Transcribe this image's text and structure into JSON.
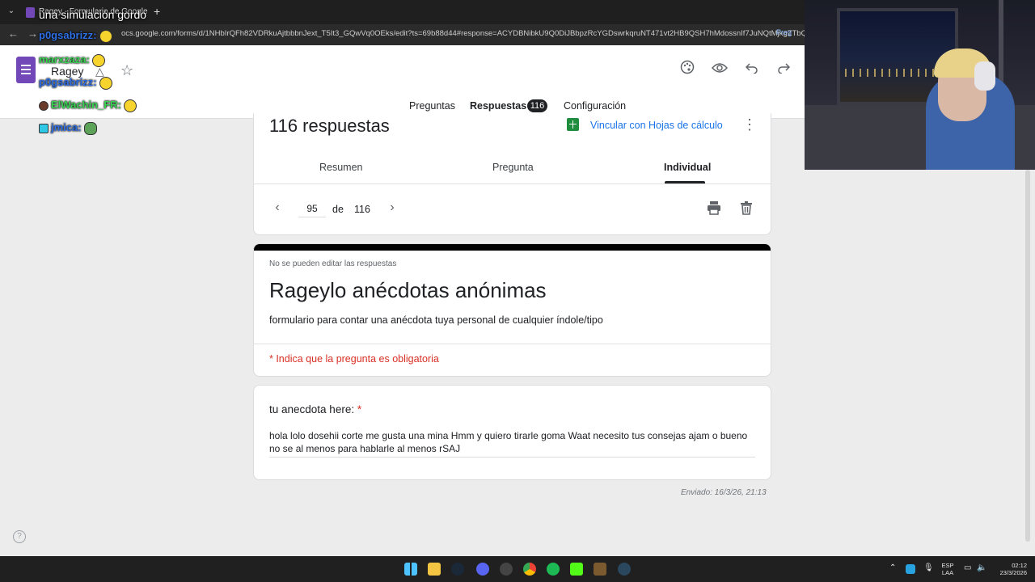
{
  "browser": {
    "tab_title": "Ragey - Formulario de Google",
    "url": "ocs.google.com/forms/d/1NHbIrQFh82VDRkuAjtbbbnJext_T5It3_GQwVq0OEks/edit?ts=69b88d44#response=ACYDBNibkU9Q0DiJBbpzRcYGDswrkqruNT471vt2HB9QSH7hMdossnIf7JuNQtMjkgZTbQk",
    "url_right": "Preg"
  },
  "header": {
    "doc_title": "Ragey",
    "tabs": {
      "questions": "Preguntas",
      "responses": "Respuestas",
      "responses_count": "116",
      "settings": "Configuración"
    }
  },
  "chat": {
    "caption": "una simulación gordo",
    "messages": [
      {
        "user": "p0gsabrizz",
        "color": "#2f6fe6"
      },
      {
        "user": "marxzaza",
        "color": "#39d353"
      },
      {
        "user": "p0gsabrizz",
        "color": "#2f6fe6"
      },
      {
        "user": "ElWachin_FR",
        "color": "#39d353"
      },
      {
        "user": "jmica",
        "color": "#2f6fe6"
      }
    ]
  },
  "responses_card": {
    "count_title": "116 respuestas",
    "link_sheets": "Vincular con Hojas de cálculo",
    "sub_tabs": {
      "summary": "Resumen",
      "question": "Pregunta",
      "individual": "Individual"
    },
    "pager": {
      "current": "95",
      "of_label": "de",
      "total": "116"
    }
  },
  "form": {
    "no_edit_note": "No se pueden editar las respuestas",
    "title": "Rageylo anécdotas anónimas",
    "description": "formulario para contar una anécdota tuya personal de cualquier índole/tipo",
    "required_note": "* Indica que la pregunta es obligatoria",
    "question_label": "tu anecdota here:",
    "required_star": "*",
    "answer": "hola lolo dosehii corte me gusta una mina Hmm y quiero tirarle goma Waat necesito tus consejas ajam o bueno no se al menos para hablarle al menos rSAJ",
    "sent": "Enviado: 16/3/26, 21:13"
  },
  "taskbar": {
    "lang_top": "ESP",
    "lang_bottom": "LAA",
    "time": "02:12",
    "date": "23/3/2026"
  }
}
